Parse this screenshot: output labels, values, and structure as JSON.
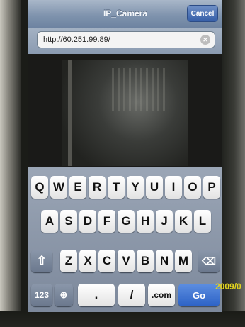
{
  "navbar": {
    "title": "IP_Camera",
    "cancel_label": "Cancel"
  },
  "urlbar": {
    "value": "http://60.251.99.89/",
    "clear_icon": "clear-icon"
  },
  "keyboard": {
    "row1": [
      "Q",
      "W",
      "E",
      "R",
      "T",
      "Y",
      "U",
      "I",
      "O",
      "P"
    ],
    "row2": [
      "A",
      "S",
      "D",
      "F",
      "G",
      "H",
      "J",
      "K",
      "L"
    ],
    "row3": [
      "Z",
      "X",
      "C",
      "V",
      "B",
      "N",
      "M"
    ],
    "shift_icon": "⇧",
    "delete_icon": "⌫",
    "numbers_label": "123",
    "globe_icon": "🌐",
    "dot_label": ".",
    "slash_label": "/",
    "dotcom_label": ".com",
    "go_label": "Go"
  },
  "photo_timestamp": "2009/0"
}
